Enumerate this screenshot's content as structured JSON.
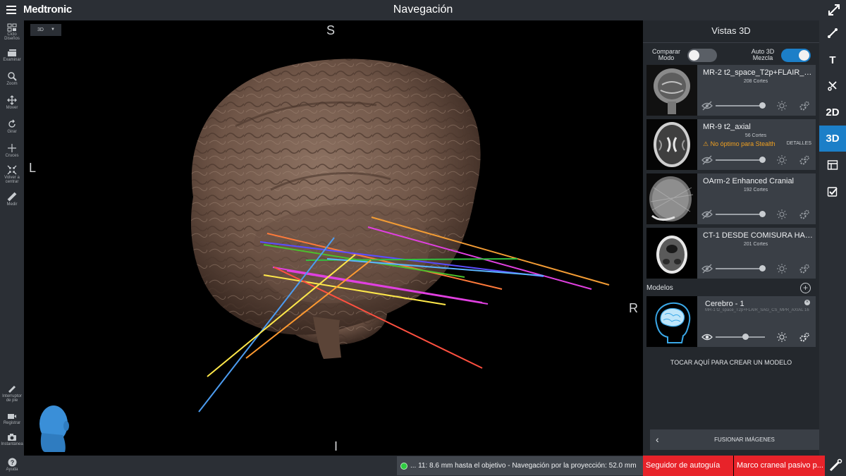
{
  "app": {
    "brand": "Medtronic",
    "title": "Navegación"
  },
  "left_toolbar": {
    "items": [
      {
        "label": "Ciclo Diseños",
        "icon": "layout-cycle-icon"
      },
      {
        "label": "Examinar",
        "icon": "browse-stack-icon"
      },
      {
        "label": "Zoom",
        "icon": "zoom-icon"
      },
      {
        "label": "Mover",
        "icon": "move-icon"
      },
      {
        "label": "Girar",
        "icon": "rotate-icon"
      },
      {
        "label": "Cruces",
        "icon": "crosshair-icon"
      },
      {
        "label": "Volver a centrar",
        "icon": "recenter-icon"
      },
      {
        "label": "Medir",
        "icon": "ruler-icon"
      },
      {
        "label": "Interruptor de pie",
        "icon": "footswitch-icon"
      },
      {
        "label": "Registrar",
        "icon": "record-icon"
      },
      {
        "label": "Instantánea",
        "icon": "camera-icon"
      },
      {
        "label": "Ayuda",
        "icon": "help-icon"
      }
    ]
  },
  "viewport": {
    "view_selector": "3D",
    "orientation": {
      "top": "S",
      "bottom": "I",
      "left": "L",
      "right": "R"
    }
  },
  "status_bar": {
    "indicator_color": "#2ecc40",
    "text": "... 11: 8.6 mm hasta el objetivo - Navegación por la proyección: 52.0 mm"
  },
  "bottom_buttons": {
    "tracker": "Seguidor de autoguía",
    "frame": "Marco craneal pasivo p..."
  },
  "right_panel": {
    "title": "Vistas 3D",
    "compare_mode": {
      "label": "Comparar Modo",
      "on": false
    },
    "auto_3d": {
      "label": "Auto 3D Mezcla",
      "on": true
    },
    "series": [
      {
        "name": "MR-2 t2_space_T2p+FLAIR_S...",
        "count": "208 Cortes",
        "slider": 0.92
      },
      {
        "name": "MR-9 t2_axial",
        "count": "56 Cortes",
        "warning": "No óptimo para Stealth",
        "details": "DETALLES",
        "slider": 0.92
      },
      {
        "name": "OArm-2 Enhanced Cranial",
        "count": "192 Cortes",
        "slider": 0.92
      },
      {
        "name": "CT-1 DESDE COMISURA HAST...",
        "count": "201 Cortes",
        "slider": 0.92
      }
    ],
    "models_label": "Modelos",
    "model": {
      "name": "Cerebro - 1",
      "sub": "MR-1 t2_space_T2p+FLAIR_SAG_CS_MPR_AXIAL 16",
      "slider": 0.6
    },
    "create_model": "TOCAR AQUÍ PARA CREAR UN MODELO",
    "fuse_button": "FUSIONAR IMÁGENES"
  },
  "right_toolbar": {
    "items": [
      {
        "icon": "trajectory-icon",
        "label": ""
      },
      {
        "icon": "text-icon",
        "label": "T"
      },
      {
        "icon": "scissors-icon",
        "label": ""
      },
      {
        "icon": "view-2d-icon",
        "label": "2D"
      },
      {
        "icon": "view-3d-icon",
        "label": "3D",
        "active": true
      },
      {
        "icon": "layout-icon",
        "label": ""
      },
      {
        "icon": "checklist-icon",
        "label": ""
      }
    ],
    "accent_color": "#1c7fc8"
  }
}
